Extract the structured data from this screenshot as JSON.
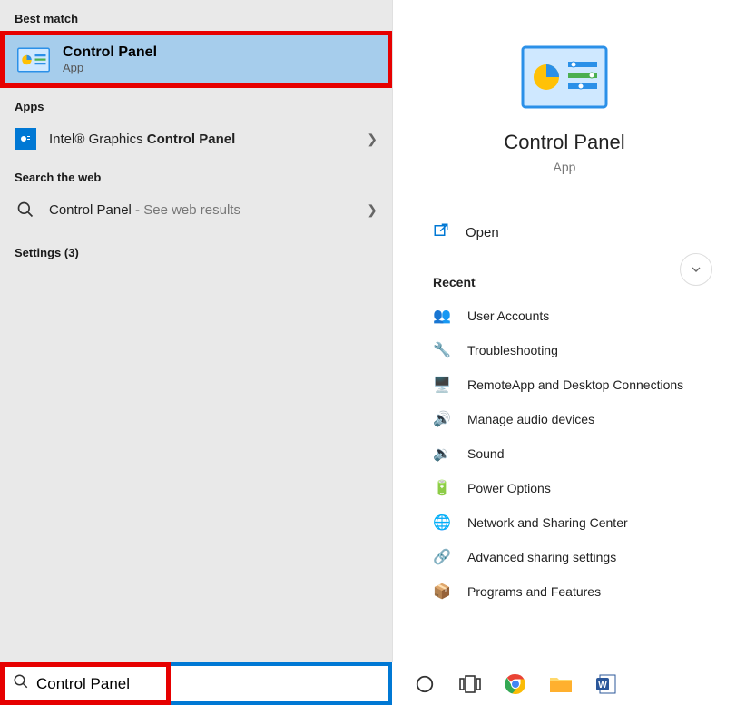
{
  "left": {
    "best_match_header": "Best match",
    "best_match": {
      "title": "Control Panel",
      "subtitle": "App"
    },
    "apps_header": "Apps",
    "apps_item_prefix": "Intel® Graphics ",
    "apps_item_bold": "Control Panel",
    "web_header": "Search the web",
    "web_item_main": "Control Panel",
    "web_item_suffix": " - See web results",
    "settings_header": "Settings (3)"
  },
  "detail": {
    "title": "Control Panel",
    "subtitle": "App",
    "open_label": "Open",
    "recent_header": "Recent",
    "recent": [
      {
        "label": "User Accounts"
      },
      {
        "label": "Troubleshooting"
      },
      {
        "label": "RemoteApp and Desktop Connections"
      },
      {
        "label": "Manage audio devices"
      },
      {
        "label": "Sound"
      },
      {
        "label": "Power Options"
      },
      {
        "label": "Network and Sharing Center"
      },
      {
        "label": "Advanced sharing settings"
      },
      {
        "label": "Programs and Features"
      }
    ]
  },
  "search": {
    "value": "Control Panel"
  }
}
